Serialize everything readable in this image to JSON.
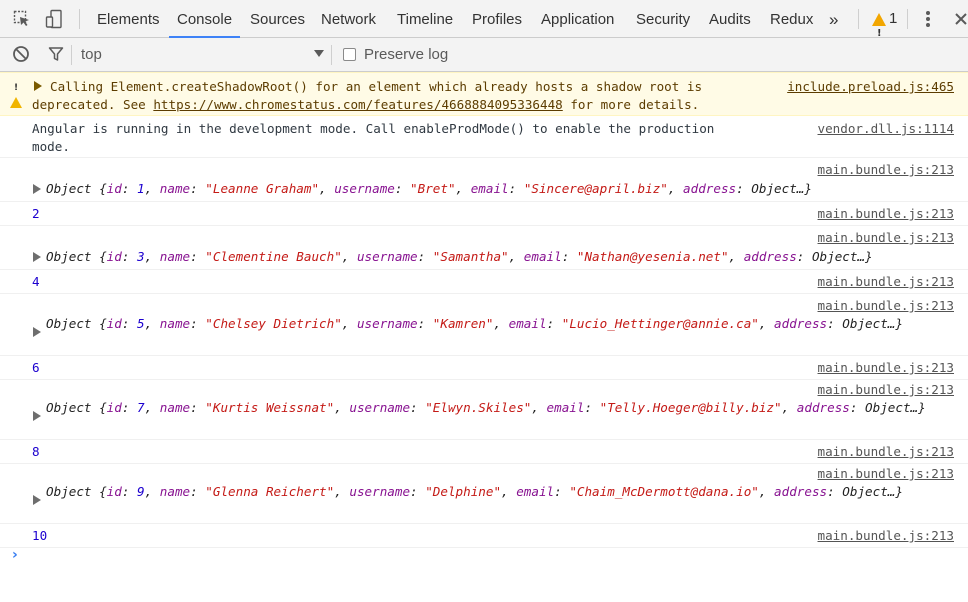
{
  "tabs": [
    "Elements",
    "Console",
    "Sources",
    "Network",
    "Timeline",
    "Profiles",
    "Application",
    "Security",
    "Audits",
    "Redux"
  ],
  "selected_tab": "Console",
  "more_tabs_glyph": "»",
  "warning_count": "1",
  "filter": {
    "context": "top",
    "preserve_log_label": "Preserve log"
  },
  "icons": {
    "inspect": "inspect-element-icon",
    "device": "device-toolbar-icon",
    "clear": "clear-console-icon",
    "filter": "filter-icon",
    "menu": "kebab-menu-icon",
    "close": "close-icon"
  },
  "colors": {
    "accent": "#3e82f7",
    "warning_bg": "#fffbe6",
    "warning_icon": "#f0b400",
    "property": "#881391",
    "string": "#c41a16",
    "number": "#1c00cf"
  },
  "messages": {
    "warning": {
      "text_before_link": "Calling Element.createShadowRoot() for an element which already hosts a shadow root is\ndeprecated. See ",
      "link": "https://www.chromestatus.com/features/4668884095336448",
      "text_after_link": " for more details.",
      "source": "include.preload.js:465"
    },
    "angular": {
      "text": "Angular is running in the development mode. Call enableProdMode() to enable the production\nmode.",
      "source": "vendor.dll.js:1114"
    },
    "obj1": {
      "source": "main.bundle.js:213",
      "label": "Object",
      "id": "1",
      "name": "\"Leanne Graham\"",
      "username": "\"Bret\"",
      "email": "\"Sincere@april.biz\"",
      "address_tail": "Object…}"
    },
    "n2": {
      "value": "2",
      "source": "main.bundle.js:213"
    },
    "obj3": {
      "source": "main.bundle.js:213",
      "label": "Object",
      "id": "3",
      "name": "\"Clementine Bauch\"",
      "username": "\"Samantha\"",
      "email": "\"Nathan@yesenia.net\"",
      "address_tail": "Object…}"
    },
    "n4": {
      "value": "4",
      "source": "main.bundle.js:213"
    },
    "obj5": {
      "source": "main.bundle.js:213",
      "label": "Object",
      "id": "5",
      "name": "\"Chelsey Dietrich\"",
      "username": "\"Kamren\"",
      "email": "\"Lucio_Hettinger@annie.ca\"",
      "address_tail": "Object…}"
    },
    "n6": {
      "value": "6",
      "source": "main.bundle.js:213"
    },
    "obj7": {
      "source": "main.bundle.js:213",
      "label": "Object",
      "id": "7",
      "name": "\"Kurtis Weissnat\"",
      "username": "\"Elwyn.Skiles\"",
      "email": "\"Telly.Hoeger@billy.biz\"",
      "address_tail": "Object…}"
    },
    "n8": {
      "value": "8",
      "source": "main.bundle.js:213"
    },
    "obj9": {
      "source": "main.bundle.js:213",
      "label": "Object",
      "id": "9",
      "name": "\"Glenna Reichert\"",
      "username": "\"Delphine\"",
      "email": "\"Chaim_McDermott@dana.io\"",
      "address_tail": "Object…}"
    },
    "n10": {
      "value": "10",
      "source": "main.bundle.js:213"
    }
  },
  "keys": {
    "id": "id",
    "name": "name",
    "username": "username",
    "email": "email",
    "address": "address"
  },
  "prompt_glyph": "›"
}
